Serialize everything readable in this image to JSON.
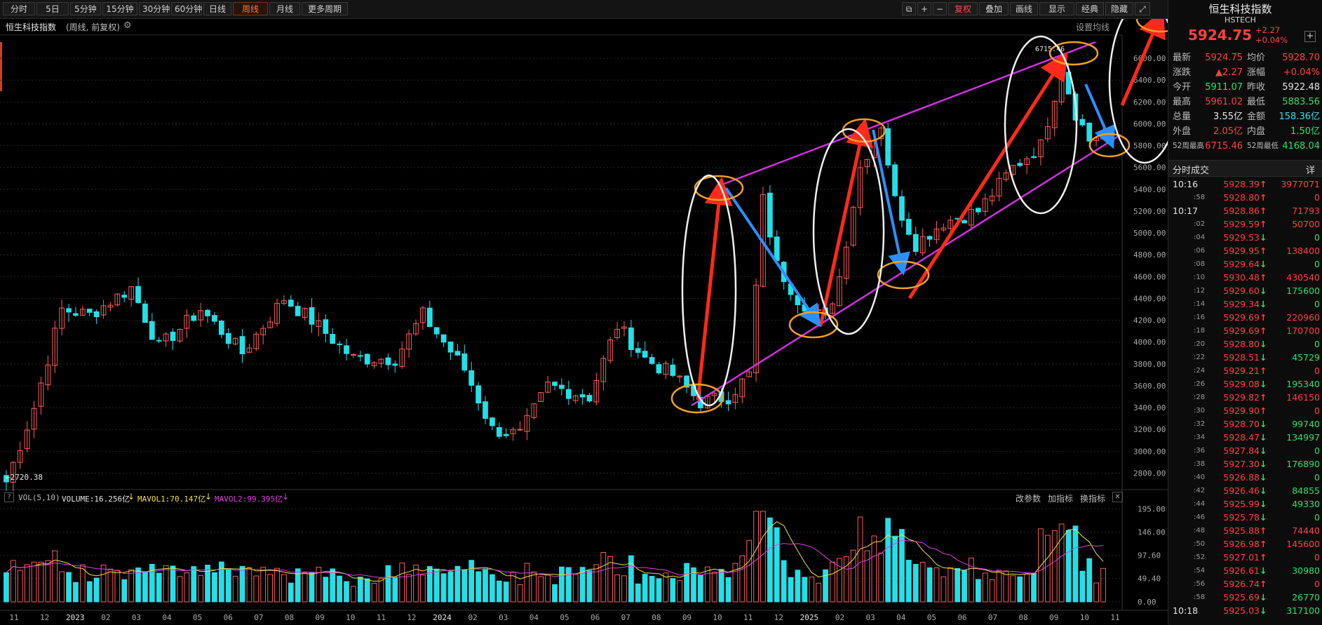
{
  "toolbar": {
    "periods": [
      "分时",
      "5日",
      "5分钟",
      "15分钟",
      "30分钟",
      "60分钟",
      "日线",
      "周线",
      "月线",
      "更多周期"
    ],
    "active_period": "周线",
    "right_buttons": [
      "复权",
      "叠加",
      "画线",
      "显示",
      "经典",
      "隐藏"
    ]
  },
  "info": {
    "index_name": "恒生科技指数",
    "mode": "(周线, 前复权)",
    "ma_setting": "设置均线"
  },
  "panel": {
    "title": "恒生科技指数",
    "code": "HSTECH",
    "price": "5924.75",
    "change": "+2.27",
    "change_pct": "+0.04%",
    "quotes": [
      {
        "l1": "最新",
        "v1": "5924.75",
        "c1": "up",
        "l2": "均价",
        "v2": "5928.70",
        "c2": "up"
      },
      {
        "l1": "涨跌",
        "v1": "▲2.27",
        "c1": "up",
        "l2": "涨幅",
        "v2": "+0.04%",
        "c2": "up"
      },
      {
        "l1": "今开",
        "v1": "5911.07",
        "c1": "dn",
        "l2": "昨收",
        "v2": "5922.48",
        "c2": "wh"
      },
      {
        "l1": "最高",
        "v1": "5961.02",
        "c1": "up",
        "l2": "最低",
        "v2": "5883.56",
        "c2": "dn"
      },
      {
        "l1": "总量",
        "v1": "3.55亿",
        "c1": "wh",
        "l2": "金额",
        "v2": "158.36亿",
        "c2": "cy"
      },
      {
        "l1": "外盘",
        "v1": "2.05亿",
        "c1": "up",
        "l2": "内盘",
        "v2": "1.50亿",
        "c2": "dn"
      },
      {
        "l1": "52周最高",
        "v1": "6715.46",
        "c1": "up",
        "l2": "52周最低",
        "v2": "4168.04",
        "c2": "dn"
      }
    ],
    "ticks_title": "分时成交",
    "ticks_detail": "详",
    "ticks": [
      {
        "t": "10:16",
        "p": "5928.39",
        "d": "↑",
        "v": "3977071"
      },
      {
        "t": ":58",
        "p": "5928.80",
        "d": "↑",
        "v": "0"
      },
      {
        "t": "10:17",
        "p": "5928.86",
        "d": "↑",
        "v": "71793"
      },
      {
        "t": ":02",
        "p": "5929.59",
        "d": "↑",
        "v": "50700"
      },
      {
        "t": ":04",
        "p": "5929.53",
        "d": "↓",
        "v": "0"
      },
      {
        "t": ":06",
        "p": "5929.95",
        "d": "↑",
        "v": "138400"
      },
      {
        "t": ":08",
        "p": "5929.64",
        "d": "↓",
        "v": "0"
      },
      {
        "t": ":10",
        "p": "5930.48",
        "d": "↑",
        "v": "430540"
      },
      {
        "t": ":12",
        "p": "5929.60",
        "d": "↓",
        "v": "175600"
      },
      {
        "t": ":14",
        "p": "5929.34",
        "d": "↓",
        "v": "0"
      },
      {
        "t": ":16",
        "p": "5929.69",
        "d": "↑",
        "v": "220960"
      },
      {
        "t": ":18",
        "p": "5929.69",
        "d": "↑",
        "v": "170700"
      },
      {
        "t": ":20",
        "p": "5928.80",
        "d": "↓",
        "v": "0"
      },
      {
        "t": ":22",
        "p": "5928.51",
        "d": "↓",
        "v": "45729"
      },
      {
        "t": ":24",
        "p": "5929.21",
        "d": "↑",
        "v": "0"
      },
      {
        "t": ":26",
        "p": "5929.08",
        "d": "↓",
        "v": "195340"
      },
      {
        "t": ":28",
        "p": "5929.82",
        "d": "↑",
        "v": "146150"
      },
      {
        "t": ":30",
        "p": "5929.90",
        "d": "↑",
        "v": "0"
      },
      {
        "t": ":32",
        "p": "5928.70",
        "d": "↓",
        "v": "99740"
      },
      {
        "t": ":34",
        "p": "5928.47",
        "d": "↓",
        "v": "134997"
      },
      {
        "t": ":36",
        "p": "5927.84",
        "d": "↓",
        "v": "0"
      },
      {
        "t": ":38",
        "p": "5927.30",
        "d": "↓",
        "v": "176890"
      },
      {
        "t": ":40",
        "p": "5926.88",
        "d": "↓",
        "v": "0"
      },
      {
        "t": ":42",
        "p": "5926.46",
        "d": "↓",
        "v": "84855"
      },
      {
        "t": ":44",
        "p": "5925.99",
        "d": "↓",
        "v": "49330"
      },
      {
        "t": ":46",
        "p": "5925.78",
        "d": "↓",
        "v": "0"
      },
      {
        "t": ":48",
        "p": "5925.88",
        "d": "↑",
        "v": "74440"
      },
      {
        "t": ":50",
        "p": "5926.98",
        "d": "↑",
        "v": "145600"
      },
      {
        "t": ":52",
        "p": "5927.01",
        "d": "↑",
        "v": "0"
      },
      {
        "t": ":54",
        "p": "5926.61",
        "d": "↓",
        "v": "30980"
      },
      {
        "t": ":56",
        "p": "5926.74",
        "d": "↑",
        "v": "0"
      },
      {
        "t": ":58",
        "p": "5925.69",
        "d": "↓",
        "v": "26770"
      },
      {
        "t": "10:18",
        "p": "5925.03",
        "d": "↓",
        "v": "317100"
      }
    ]
  },
  "volume_panel": {
    "label": "VOL(5,10)",
    "volume": "VOLUME:16.256亿",
    "mavol1": "MAVOL1:70.147亿",
    "mavol2": "MAVOL2:99.395亿",
    "buttons": [
      "改参数",
      "加指标",
      "换指标"
    ]
  },
  "chart_data": {
    "type": "candlestick",
    "price_axis_ticks": [
      "6600.00",
      "6400.00",
      "6200.00",
      "6000.00",
      "5800.00",
      "5600.00",
      "5400.00",
      "5200.00",
      "5000.00",
      "4800.00",
      "4600.00",
      "4400.00",
      "4200.00",
      "4000.00",
      "3800.00",
      "3600.00",
      "3400.00",
      "3200.00",
      "3000.00",
      "2800.00"
    ],
    "volume_axis_ticks": [
      "195.00",
      "146.00",
      "97.60",
      "49.40",
      "0.00"
    ],
    "x_labels": [
      "11",
      "12",
      "2023",
      "02",
      "03",
      "04",
      "05",
      "06",
      "07",
      "08",
      "09",
      "10",
      "11",
      "12",
      "2024",
      "02",
      "03",
      "04",
      "05",
      "06",
      "07",
      "08",
      "09",
      "10",
      "11",
      "12",
      "2025",
      "02",
      "03",
      "04",
      "05",
      "06",
      "07",
      "08",
      "09",
      "10",
      "11"
    ],
    "annotations": {
      "low_label": "←2720.38",
      "high_label": "6715.46"
    },
    "price_range": [
      2700,
      6800
    ],
    "volume_range": [
      0,
      200
    ],
    "anchors": [
      {
        "i": 0,
        "c": 2720
      },
      {
        "i": 4,
        "c": 3400
      },
      {
        "i": 8,
        "c": 4300
      },
      {
        "i": 12,
        "c": 4250
      },
      {
        "i": 18,
        "c": 4500
      },
      {
        "i": 22,
        "c": 3950
      },
      {
        "i": 28,
        "c": 4300
      },
      {
        "i": 34,
        "c": 3900
      },
      {
        "i": 40,
        "c": 4400
      },
      {
        "i": 44,
        "c": 4200
      },
      {
        "i": 50,
        "c": 3850
      },
      {
        "i": 56,
        "c": 3850
      },
      {
        "i": 60,
        "c": 4250
      },
      {
        "i": 66,
        "c": 3750
      },
      {
        "i": 70,
        "c": 3200
      },
      {
        "i": 74,
        "c": 3150
      },
      {
        "i": 78,
        "c": 3600
      },
      {
        "i": 84,
        "c": 3500
      },
      {
        "i": 88,
        "c": 4150
      },
      {
        "i": 92,
        "c": 3850
      },
      {
        "i": 96,
        "c": 3700
      },
      {
        "i": 100,
        "c": 3450
      },
      {
        "i": 104,
        "c": 3500
      },
      {
        "i": 107,
        "c": 3700
      },
      {
        "i": 109,
        "c": 5300
      },
      {
        "i": 111,
        "c": 4700
      },
      {
        "i": 114,
        "c": 4400
      },
      {
        "i": 118,
        "c": 4200
      },
      {
        "i": 120,
        "c": 4600
      },
      {
        "i": 123,
        "c": 5600
      },
      {
        "i": 126,
        "c": 6000
      },
      {
        "i": 128,
        "c": 5300
      },
      {
        "i": 131,
        "c": 4900
      },
      {
        "i": 135,
        "c": 5100
      },
      {
        "i": 140,
        "c": 5200
      },
      {
        "i": 145,
        "c": 5600
      },
      {
        "i": 149,
        "c": 5800
      },
      {
        "i": 152,
        "c": 6500
      },
      {
        "i": 154,
        "c": 6100
      },
      {
        "i": 156,
        "c": 5850
      },
      {
        "i": 158,
        "c": 5925
      }
    ]
  }
}
